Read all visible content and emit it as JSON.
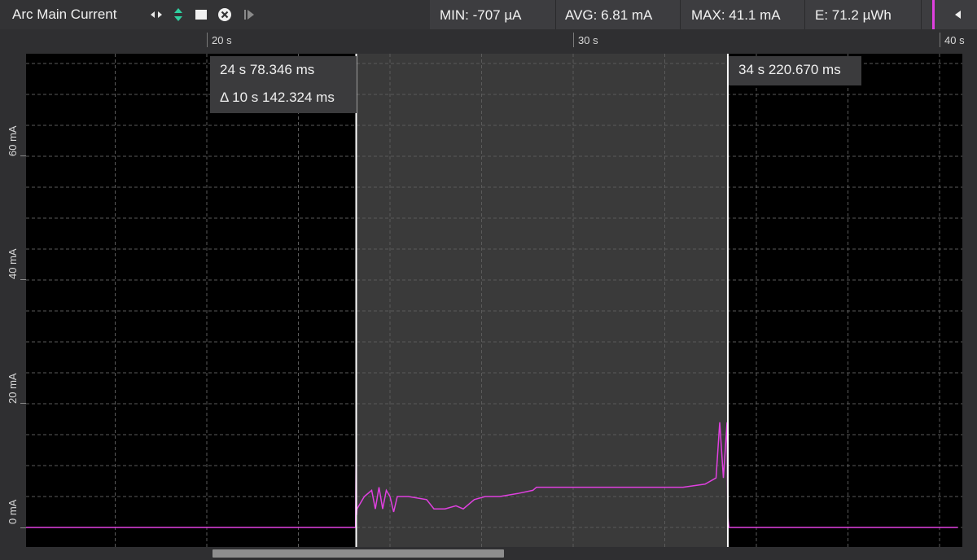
{
  "toolbar": {
    "title": "Arc Main Current",
    "icons": [
      "pan-horizontal-icon",
      "zoom-vertical-icon",
      "stop-icon",
      "clear-icon",
      "step-forward-icon"
    ]
  },
  "stats": {
    "min": "MIN: -707 µA",
    "avg": "AVG: 6.81 mA",
    "max": "MAX: 41.1 mA",
    "energy": "E: 71.2 µWh"
  },
  "colors": {
    "trace": "#e040e0",
    "selection": "#3a3a3a",
    "accent": "#e040e0"
  },
  "cursors": {
    "left": {
      "time": "24 s 78.346 ms",
      "delta": "Δ 10 s 142.324 ms"
    },
    "right": {
      "time": "34 s 220.670 ms"
    }
  },
  "chart_data": {
    "type": "line",
    "xlabel": "",
    "ylabel": "",
    "x_tick_labels": [
      "20 s",
      "30 s",
      "40 s"
    ],
    "y_tick_labels": [
      "0 mA",
      "20 mA",
      "40 mA",
      "60 mA"
    ],
    "xlim": [
      15.0,
      40.5
    ],
    "ylim": [
      -5,
      75
    ],
    "selection": [
      24.078,
      34.221
    ],
    "series": [
      {
        "values": [
          [
            15.0,
            0
          ],
          [
            24.06,
            0
          ],
          [
            24.08,
            18
          ],
          [
            24.09,
            2
          ],
          [
            24.1,
            3
          ],
          [
            24.3,
            5
          ],
          [
            24.5,
            6
          ],
          [
            24.6,
            3
          ],
          [
            24.7,
            6.5
          ],
          [
            24.8,
            3
          ],
          [
            24.9,
            6
          ],
          [
            25.0,
            5
          ],
          [
            25.1,
            2.5
          ],
          [
            25.2,
            5
          ],
          [
            25.5,
            5
          ],
          [
            26.0,
            4.5
          ],
          [
            26.2,
            3
          ],
          [
            26.5,
            3
          ],
          [
            26.8,
            3.5
          ],
          [
            27.0,
            3
          ],
          [
            27.3,
            4.5
          ],
          [
            27.6,
            5
          ],
          [
            28.0,
            5
          ],
          [
            28.5,
            5.5
          ],
          [
            28.9,
            6
          ],
          [
            29.0,
            6.5
          ],
          [
            30.0,
            6.5
          ],
          [
            31.0,
            6.5
          ],
          [
            32.0,
            6.5
          ],
          [
            33.0,
            6.5
          ],
          [
            33.6,
            7
          ],
          [
            33.9,
            8
          ],
          [
            34.0,
            17
          ],
          [
            34.1,
            8
          ],
          [
            34.2,
            17
          ],
          [
            34.22,
            2
          ],
          [
            34.25,
            0
          ],
          [
            40.5,
            0
          ]
        ]
      }
    ]
  }
}
